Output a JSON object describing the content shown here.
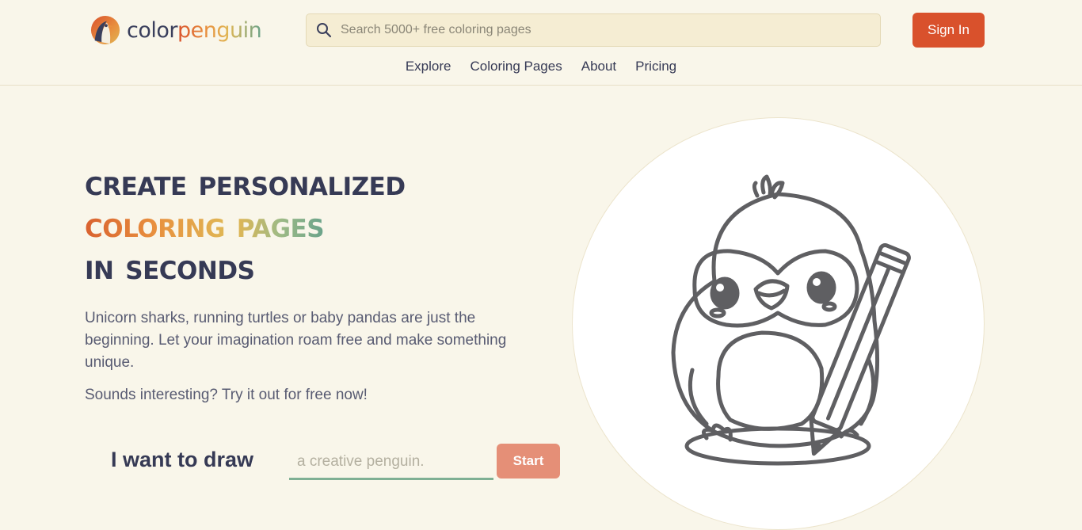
{
  "brand": {
    "name_part1": "color",
    "name_part2": "penguin",
    "colors": [
      "#d9512c",
      "#e8903e",
      "#e0b654",
      "#8fb58a",
      "#6aa38a"
    ]
  },
  "search": {
    "placeholder": "Search 5000+ free coloring pages",
    "value": ""
  },
  "header": {
    "signin_label": "Sign In",
    "accent": "#d9512c"
  },
  "nav": {
    "items": [
      "Explore",
      "Coloring Pages",
      "About",
      "Pricing"
    ]
  },
  "hero": {
    "title_line1": "Create Personalized",
    "title_line2_word1": "Coloring",
    "title_line2_word2": "Pages",
    "title_line3": "in seconds",
    "description": "Unicorn sharks, running turtles or baby pandas are just the beginning. Let your imagination roam free and make something unique.",
    "tagline": "Sounds interesting? Try it out for free now!"
  },
  "draw": {
    "label": "I want to draw",
    "placeholder": "a creative penguin.",
    "value": "",
    "start_label": "Start"
  }
}
